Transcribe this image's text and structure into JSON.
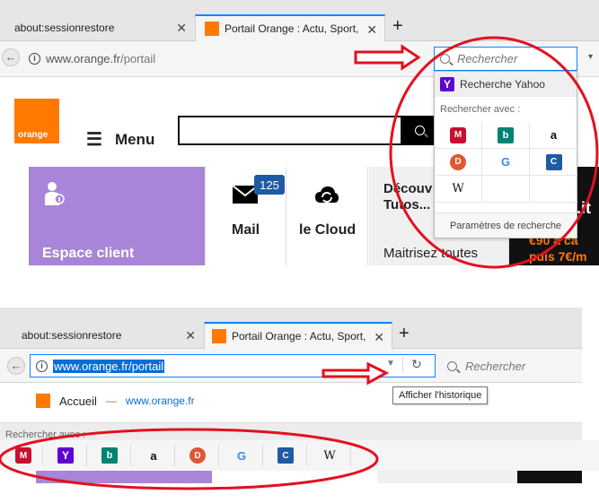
{
  "top": {
    "tabs": [
      {
        "label": "about:sessionrestore"
      },
      {
        "label": "Portail Orange : Actu, Sport,"
      }
    ],
    "url": {
      "domain": "www.orange.fr",
      "path": "/portail"
    },
    "search_placeholder": "Rechercher",
    "site": {
      "logo_text": "orange",
      "menu_label": "Menu",
      "espace_client": "Espace client",
      "mail_label": "Mail",
      "mail_badge": "125",
      "cloud_label": "le Cloud",
      "promo_title_1": "Découv",
      "promo_title_2": "Tutos...",
      "promo_text": "Maitrisez toutes",
      "ad_text_1": ".it",
      "ad_text_2": "€90 à ca",
      "ad_text_3": "puis 7€/m"
    },
    "dropdown": {
      "yahoo_label": "Recherche Yahoo",
      "search_with": "Rechercher avec :",
      "settings": "Paramètres de recherche",
      "engines": [
        {
          "name": "mcafee-icon",
          "glyph": "M"
        },
        {
          "name": "bing-icon",
          "glyph": "b"
        },
        {
          "name": "amazon-icon",
          "glyph": "a"
        },
        {
          "name": "duckduckgo-icon",
          "glyph": "D"
        },
        {
          "name": "google-icon",
          "glyph": "G"
        },
        {
          "name": "cnet-icon",
          "glyph": "C"
        },
        {
          "name": "wikipedia-icon",
          "glyph": "W"
        }
      ]
    }
  },
  "bottom": {
    "tabs": [
      {
        "label": "about:sessionrestore"
      },
      {
        "label": "Portail Orange : Actu, Sport,"
      }
    ],
    "url": "www.orange.fr/portail",
    "search_placeholder": "Rechercher",
    "tooltip": "Afficher l'historique",
    "suggestion": {
      "title": "Accueil",
      "separator": "—",
      "url": "www.orange.fr"
    },
    "search_with": "Rechercher avec :",
    "engines": [
      {
        "name": "mcafee-icon",
        "glyph": "M"
      },
      {
        "name": "yahoo-icon",
        "glyph": "Y"
      },
      {
        "name": "bing-icon",
        "glyph": "b"
      },
      {
        "name": "amazon-icon",
        "glyph": "a"
      },
      {
        "name": "duckduckgo-icon",
        "glyph": "D"
      },
      {
        "name": "google-icon",
        "glyph": "G"
      },
      {
        "name": "cnet-icon",
        "glyph": "C"
      },
      {
        "name": "wikipedia-icon",
        "glyph": "W"
      }
    ]
  },
  "colors": {
    "annotation_red": "#e3101e",
    "orange": "#ff7900",
    "accent_blue": "#0a84ff"
  }
}
